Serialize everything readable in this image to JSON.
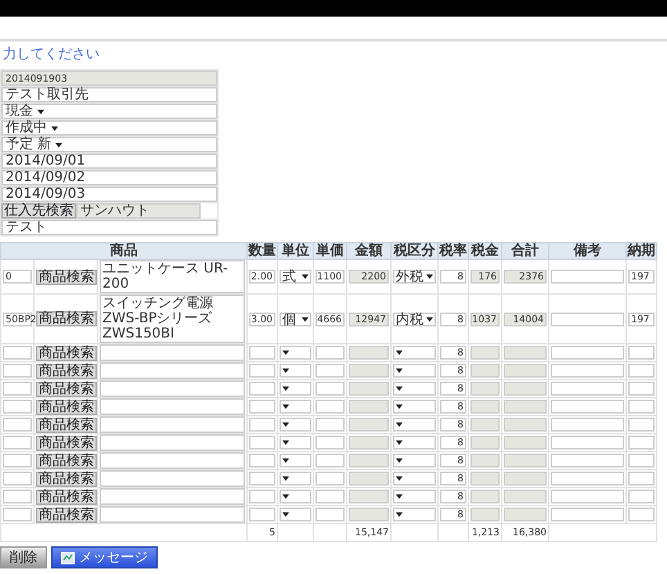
{
  "message": "力してください",
  "form": [
    {
      "kind": "readonly",
      "value": "2014091903"
    },
    {
      "kind": "text",
      "value": "テスト取引先"
    },
    {
      "kind": "select",
      "value": "現金"
    },
    {
      "kind": "select",
      "value": "作成中"
    },
    {
      "kind": "select",
      "value": "予定 新"
    },
    {
      "kind": "text",
      "value": "2014/09/01"
    },
    {
      "kind": "text",
      "value": "2014/09/02"
    },
    {
      "kind": "text",
      "value": "2014/09/03"
    },
    {
      "kind": "search",
      "button": "仕入先検索",
      "value": "サンハウト"
    },
    {
      "kind": "text",
      "value": "テスト"
    }
  ],
  "table": {
    "columns": [
      "商品",
      "数量",
      "単位",
      "単価",
      "金額",
      "税区分",
      "税率",
      "税金",
      "合計",
      "備考",
      "納期"
    ],
    "rows": [
      {
        "code": "0",
        "search_button": "商品検索",
        "name": "ユニットケース UR-200",
        "qty": "2.00",
        "unit": "式",
        "price": "1100",
        "amount": "2200",
        "tax_type": "外税",
        "tax_rate": "8",
        "tax": "176",
        "total": "2376",
        "due": "197"
      },
      {
        "code": "50BP2",
        "search_button": "商品検索",
        "name": "スイッチング電源 ZWS-BPシリーズ ZWS150BI",
        "qty": "3.00",
        "unit": "個",
        "price": "4666",
        "amount": "12947",
        "tax_type": "内税",
        "tax_rate": "8",
        "tax": "1037",
        "total": "14004",
        "due": "197"
      },
      {
        "search_button": "商品検索",
        "tax_rate": "8"
      },
      {
        "search_button": "商品検索",
        "tax_rate": "8"
      },
      {
        "search_button": "商品検索",
        "tax_rate": "8"
      },
      {
        "search_button": "商品検索",
        "tax_rate": "8"
      },
      {
        "search_button": "商品検索",
        "tax_rate": "8"
      },
      {
        "search_button": "商品検索",
        "tax_rate": "8"
      },
      {
        "search_button": "商品検索",
        "tax_rate": "8"
      },
      {
        "search_button": "商品検索",
        "tax_rate": "8"
      },
      {
        "search_button": "商品検索",
        "tax_rate": "8"
      },
      {
        "search_button": "商品検索",
        "tax_rate": "8"
      }
    ],
    "totals": {
      "qty": "5",
      "amount": "15,147",
      "tax": "1,213",
      "total": "16,380"
    }
  },
  "buttons": [
    {
      "kind": "delete",
      "label": "削除"
    },
    {
      "kind": "message",
      "label": "メッセージ"
    }
  ]
}
